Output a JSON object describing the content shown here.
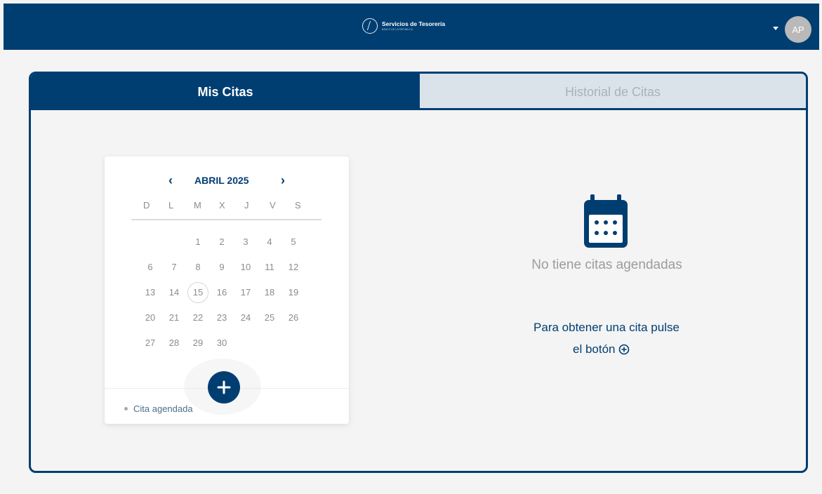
{
  "header": {
    "brand_title": "Servicios de Tesorería",
    "brand_subtitle": "BANCO DE LA REPUBLICA",
    "avatar_initials": "AP",
    "icons": {
      "logo": "institution-logo",
      "menu": "chevron-down-icon"
    },
    "colors": {
      "primary": "#003e72"
    }
  },
  "tabs": [
    {
      "label": "Mis Citas",
      "active": true
    },
    {
      "label": "Historial de Citas",
      "active": false
    }
  ],
  "calendar": {
    "month_label": "ABRIL 2025",
    "prev_icon": "chevron-left-icon",
    "next_icon": "chevron-right-icon",
    "weekdays": [
      "D",
      "L",
      "M",
      "X",
      "J",
      "V",
      "S"
    ],
    "days": [
      "",
      "",
      "1",
      "2",
      "3",
      "4",
      "5",
      "6",
      "7",
      "8",
      "9",
      "10",
      "11",
      "12",
      "13",
      "14",
      "15",
      "16",
      "17",
      "18",
      "19",
      "20",
      "21",
      "22",
      "23",
      "24",
      "25",
      "26",
      "27",
      "28",
      "29",
      "30",
      "",
      "",
      ""
    ],
    "today": "15",
    "legend": "Cita agendada"
  },
  "empty_state": {
    "icon": "calendar-icon",
    "title": "No tiene citas agendadas",
    "help_line_1": "Para obtener una cita pulse",
    "help_line_2": "el botón"
  },
  "actions": {
    "add_icon": "plus-icon"
  }
}
